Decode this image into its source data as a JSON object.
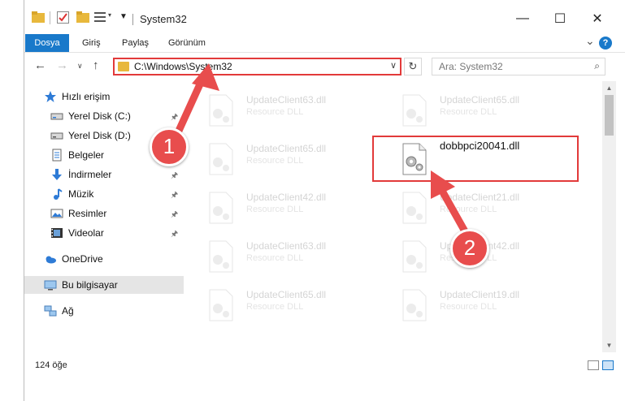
{
  "window": {
    "title": "System32",
    "minimize_glyph": "—",
    "maximize_glyph": "☐",
    "close_glyph": "✕"
  },
  "ribbon": {
    "tabs": [
      "Dosya",
      "Giriş",
      "Paylaş",
      "Görünüm"
    ],
    "expand_glyph": "⌄",
    "help_glyph": "?"
  },
  "address": {
    "path": "C:\\Windows\\System32",
    "dropdown_glyph": "∨",
    "refresh_glyph": "↻"
  },
  "search": {
    "placeholder": "Ara: System32",
    "icon_glyph": "⌕"
  },
  "sidebar": {
    "items": [
      {
        "label": "Hızlı erişim",
        "icon": "star-icon"
      },
      {
        "label": "Yerel Disk (C:)",
        "icon": "drive-icon",
        "pinned": true
      },
      {
        "label": "Yerel Disk (D:)",
        "icon": "drive-icon",
        "pinned": true
      },
      {
        "label": "Belgeler",
        "icon": "documents-icon",
        "pinned": true
      },
      {
        "label": "İndirmeler",
        "icon": "download-icon",
        "pinned": true
      },
      {
        "label": "Müzik",
        "icon": "music-icon",
        "pinned": true
      },
      {
        "label": "Resimler",
        "icon": "pictures-icon",
        "pinned": true
      },
      {
        "label": "Videolar",
        "icon": "videos-icon",
        "pinned": true
      },
      {
        "label": "OneDrive",
        "icon": "cloud-icon"
      },
      {
        "label": "Bu bilgisayar",
        "icon": "computer-icon",
        "selected": true
      },
      {
        "label": "Ağ",
        "icon": "network-icon"
      }
    ],
    "pin_glyph": "📌"
  },
  "files": [
    {
      "name": "UpdateClient63.dll",
      "type": "Resource DLL",
      "faded": true
    },
    {
      "name": "UpdateClient65.dll",
      "type": "Resource DLL",
      "faded": true
    },
    {
      "name": "UpdateClient65.dll",
      "type": "Resource DLL",
      "faded": true
    },
    {
      "name": "dobbpci20041.dll",
      "type": "",
      "faded": false
    },
    {
      "name": "UpdateClient42.dll",
      "type": "Resource DLL",
      "faded": true
    },
    {
      "name": "UpdateClient21.dll",
      "type": "Resource DLL",
      "faded": true
    },
    {
      "name": "UpdateClient63.dll",
      "type": "Resource DLL",
      "faded": true
    },
    {
      "name": "UpdateClient42.dll",
      "type": "Resource DLL",
      "faded": true
    },
    {
      "name": "UpdateClient65.dll",
      "type": "Resource DLL",
      "faded": true
    },
    {
      "name": "UpdateClient19.dll",
      "type": "Resource DLL",
      "faded": true
    }
  ],
  "status": {
    "count": "124 öğe"
  },
  "callouts": [
    "1",
    "2"
  ],
  "colors": {
    "accent": "#1979ca",
    "annotation": "#e84d4d",
    "folder": "#e8b83c"
  }
}
